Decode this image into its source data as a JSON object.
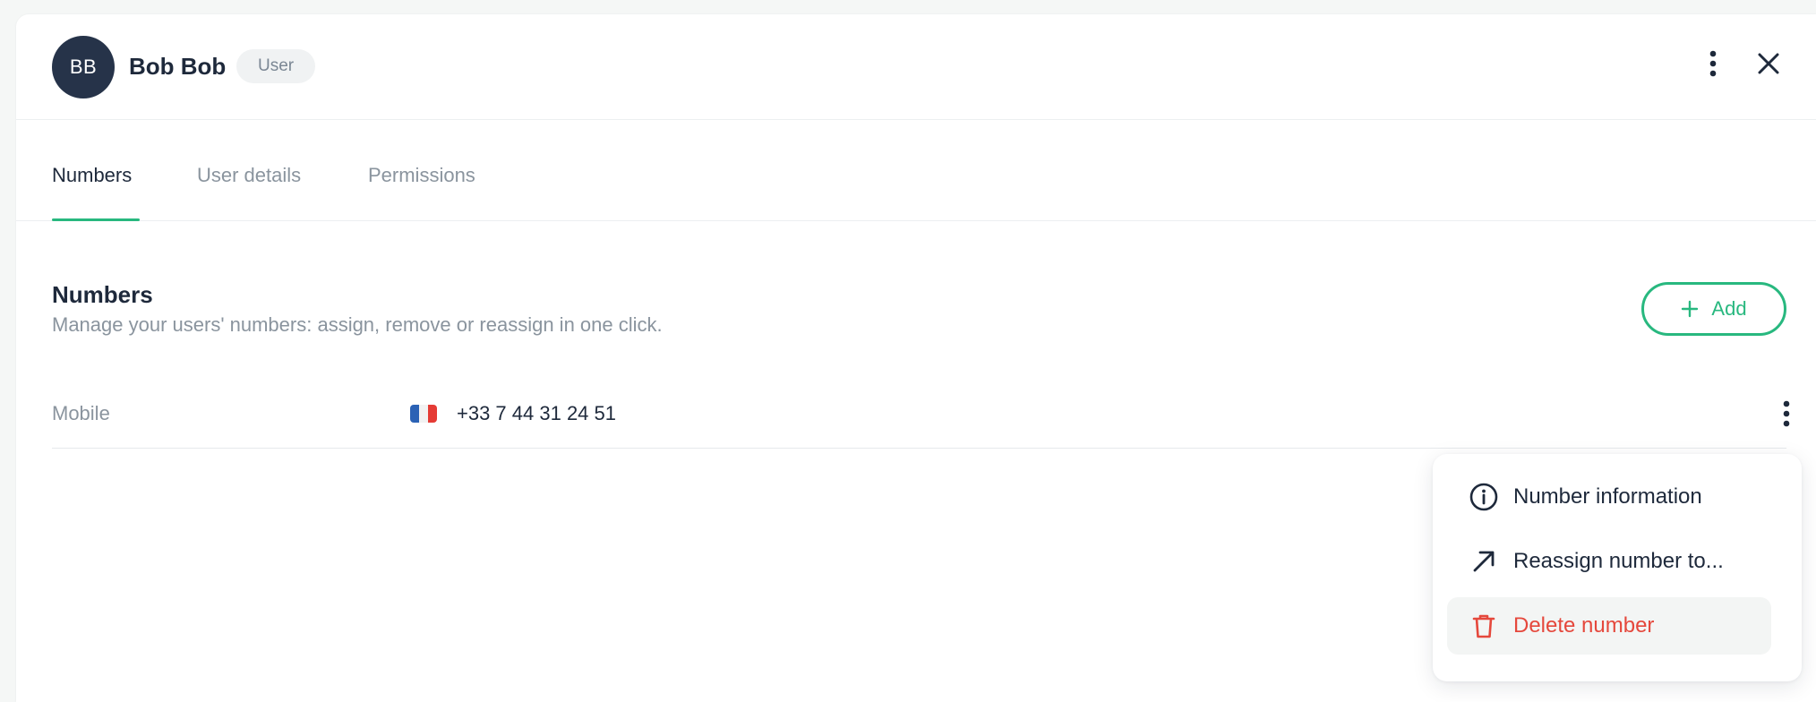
{
  "user": {
    "initials": "BB",
    "name": "Bob Bob",
    "role": "User"
  },
  "tabs": [
    {
      "label": "Numbers",
      "active": true
    },
    {
      "label": "User details",
      "active": false
    },
    {
      "label": "Permissions",
      "active": false
    }
  ],
  "numbers_section": {
    "title": "Numbers",
    "description": "Manage your users' numbers: assign, remove or reassign in one click.",
    "add_label": "Add"
  },
  "numbers": [
    {
      "type": "Mobile",
      "country_flag": "france-flag-icon",
      "number": "+33 7 44 31 24 51"
    }
  ],
  "row_menu": {
    "items": [
      {
        "label": "Number information",
        "icon": "info-icon"
      },
      {
        "label": "Reassign number to...",
        "icon": "arrow-up-right-icon"
      },
      {
        "label": "Delete number",
        "icon": "trash-icon",
        "danger": true
      }
    ]
  },
  "colors": {
    "accent": "#28b87f",
    "danger": "#e5483c",
    "avatar_bg": "#263349"
  }
}
